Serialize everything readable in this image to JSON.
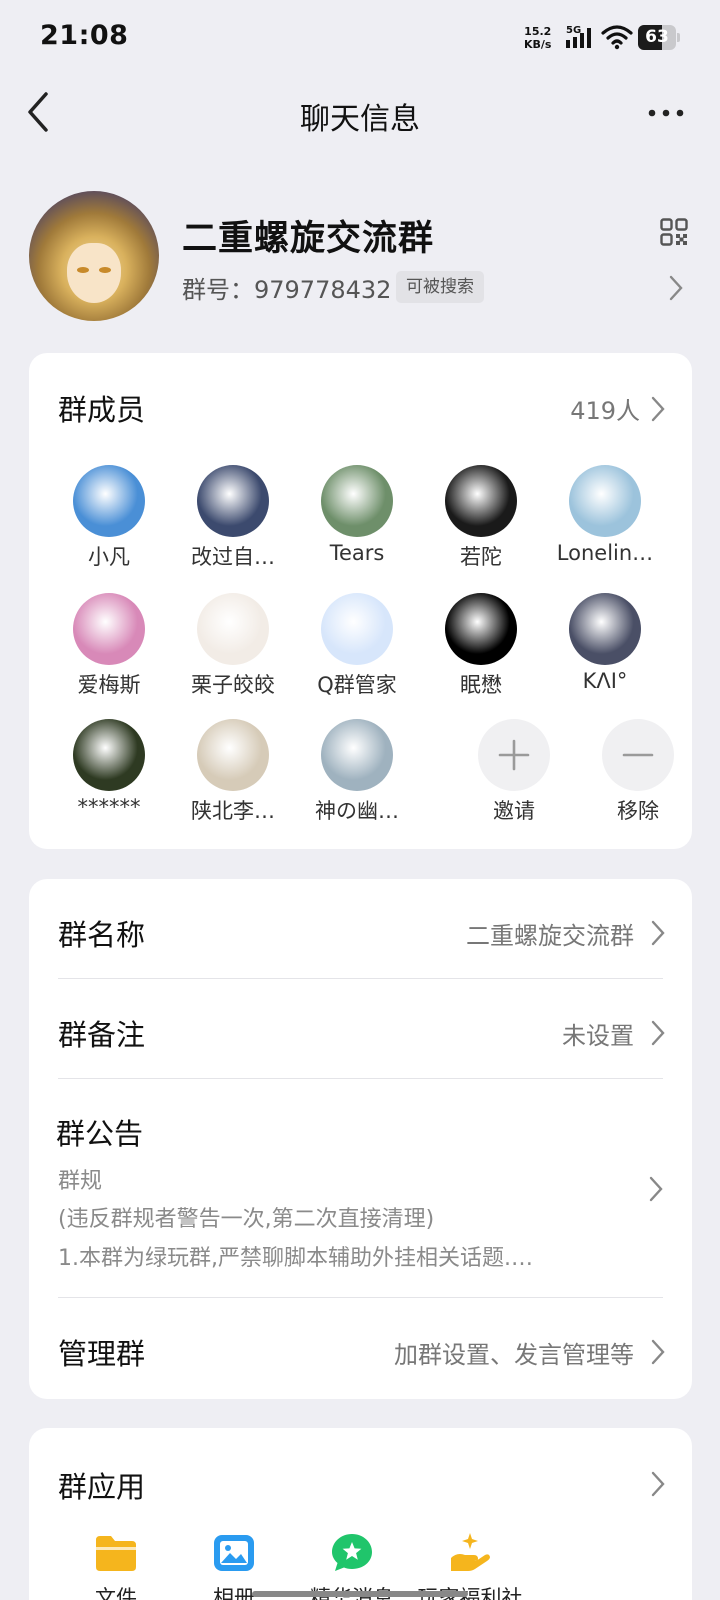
{
  "status_bar": {
    "time": "21:08",
    "speed_value": "15.2",
    "speed_unit": "KB/s",
    "network": "5G",
    "battery_level": 63
  },
  "nav": {
    "title": "聊天信息"
  },
  "group": {
    "name": "二重螺旋交流群",
    "id_label": "群号：979778432",
    "searchable_tag": "可被搜索"
  },
  "members": {
    "title": "群成员",
    "count": "419人",
    "list": [
      {
        "name": "小凡",
        "color": "#4a8fd6"
      },
      {
        "name": "改过自…",
        "color": "#3c4a6e"
      },
      {
        "name": "Tears",
        "color": "#6e8f6a"
      },
      {
        "name": "若陀",
        "color": "#1a1a1a"
      },
      {
        "name": "Lonelin…",
        "color": "#9cc3dc"
      },
      {
        "name": "爱梅斯",
        "color": "#d889b8"
      },
      {
        "name": "栗子皎皎",
        "color": "#f2ece6"
      },
      {
        "name": "Q群管家",
        "color": "#d7e6fb"
      },
      {
        "name": "眠懋",
        "color": "#000000"
      },
      {
        "name": "KΛI°",
        "color": "#4a4f66"
      },
      {
        "name": "******",
        "color": "#2e3a22"
      },
      {
        "name": "陕北李…",
        "color": "#d6cbb8"
      },
      {
        "name": "神の幽…",
        "color": "#9fb2bf"
      }
    ],
    "invite_label": "邀请",
    "remove_label": "移除"
  },
  "info": {
    "name_label": "群名称",
    "name_value": "二重螺旋交流群",
    "remark_label": "群备注",
    "remark_value": "未设置",
    "notice_label": "群公告",
    "notice_lines": [
      "群规",
      "(违反群规者警告一次,第二次直接清理)",
      "1.本群为绿玩群,严禁聊脚本辅助外挂相关话题.…"
    ],
    "manage_label": "管理群",
    "manage_value": "加群设置、发言管理等"
  },
  "apps": {
    "title": "群应用",
    "items": [
      {
        "label": "文件",
        "icon": "folder-icon",
        "color": "#f5b51d"
      },
      {
        "label": "相册",
        "icon": "photo-icon",
        "color": "#2a9bf0"
      },
      {
        "label": "精华消息",
        "icon": "star-chat-icon",
        "color": "#20c56b"
      },
      {
        "label": "玩家福利社",
        "icon": "gift-hand-icon",
        "color": "#f5b51d"
      }
    ]
  }
}
